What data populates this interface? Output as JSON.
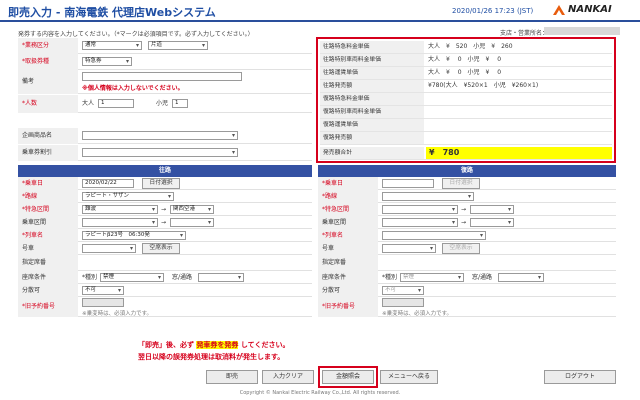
{
  "header": {
    "title": "即売入力 - 南海電鉄 代理店Webシステム",
    "datetime": "2020/01/26 17:23 (JST)",
    "logo_text": "NANKAI"
  },
  "instruction": "発券する内容を入力してください。（*マークは必須項目です。必ず入力してください。）",
  "user_info": "支店・営業所名：",
  "form": {
    "business_type": {
      "label": "*業務区分",
      "value1": "通常",
      "value2": "片道"
    },
    "ticket_type": {
      "label": "*取扱券種",
      "value": "特急券"
    },
    "remarks": {
      "label": "備考",
      "warning": "※個人情報は入力しないでください。"
    },
    "people": {
      "label": "*人数",
      "adult_label": "大人",
      "adult_value": "1",
      "child_label": "小児",
      "child_value": "1"
    },
    "plan_product": {
      "label": "企画商品名",
      "value": ""
    },
    "discount": {
      "label": "乗車券割引",
      "value": ""
    }
  },
  "fares": {
    "rows": [
      {
        "label": "往路特急料金単価",
        "value": "大人　¥　520　小児　¥　260"
      },
      {
        "label": "往路特別車両料金単価",
        "value": "大人　¥　 0　小児　¥　 0"
      },
      {
        "label": "往路運賃単価",
        "value": "大人　¥　 0　小児　¥　 0"
      },
      {
        "label": "往路発売額",
        "value": "¥780(大人　¥520×1　小児　¥260×1)"
      },
      {
        "label": "復路特急料金単価",
        "value": ""
      },
      {
        "label": "復路特別車両料金単価",
        "value": ""
      },
      {
        "label": "復路運賃単価",
        "value": ""
      },
      {
        "label": "復路発売額",
        "value": ""
      }
    ],
    "total": {
      "label": "発売額合計",
      "value": "¥　780"
    }
  },
  "outbound": {
    "heading": "往路",
    "date": {
      "label": "*乗車日",
      "value": "2020/02/22",
      "button": "日付選択"
    },
    "route": {
      "label": "*路線",
      "value": "ラピート・サザン"
    },
    "express_section": {
      "label": "*特急区間",
      "from": "難波",
      "arrow": "→",
      "to": "関西空港"
    },
    "ride_section": {
      "label": "乗車区間",
      "arrow": "→"
    },
    "train": {
      "label": "*列車名",
      "value": "ラピートβ23号　06:30発"
    },
    "car": {
      "label": "号車",
      "button": "空席表示"
    },
    "seat": {
      "label": "指定席番"
    },
    "seat_condition": {
      "label": "座席条件",
      "kind_label": "*種別",
      "kind_value": "禁煙",
      "window_label": "窓/通路"
    },
    "split": {
      "label": "分散可",
      "value": "不可"
    },
    "old_reservation": {
      "label": "*旧予約番号",
      "note": "※乗変時は、必須入力です。"
    }
  },
  "return": {
    "heading": "復路",
    "date": {
      "label": "*乗車日",
      "value": "",
      "button": "日付選択"
    },
    "route": {
      "label": "*路線",
      "value": ""
    },
    "express_section": {
      "label": "*特急区間",
      "arrow": "→"
    },
    "ride_section": {
      "label": "乗車区間",
      "arrow": "→"
    },
    "train": {
      "label": "*列車名",
      "value": ""
    },
    "car": {
      "label": "号車",
      "button": "空席表示"
    },
    "seat": {
      "label": "指定席番"
    },
    "seat_condition": {
      "label": "座席条件",
      "kind_label": "*種別",
      "kind_value": "禁煙",
      "window_label": "窓/通路"
    },
    "split": {
      "label": "分散可",
      "value": "不可"
    },
    "old_reservation": {
      "label": "*旧予約番号",
      "note": "※乗変時は、必須入力です。"
    }
  },
  "notice": {
    "line1_pre": "「即売」後、必ず",
    "line1_highlight": "発車券を発券",
    "line1_post": "してください。",
    "line2": "翌日以降の誤発券処理は取消料が発生します。"
  },
  "buttons": {
    "sell": "即売",
    "clear": "入力クリア",
    "fare_check": "金額照会",
    "back": "メニューへ戻る",
    "logout": "ログアウト"
  },
  "footer": "Copyright © Nankai Electric Railway Co.,Ltd. All rights reserved.",
  "colors": {
    "brand": "#1f4ea3",
    "section_head": "#3451a3",
    "required": "#d6001c",
    "highlight": "#ffff00"
  }
}
